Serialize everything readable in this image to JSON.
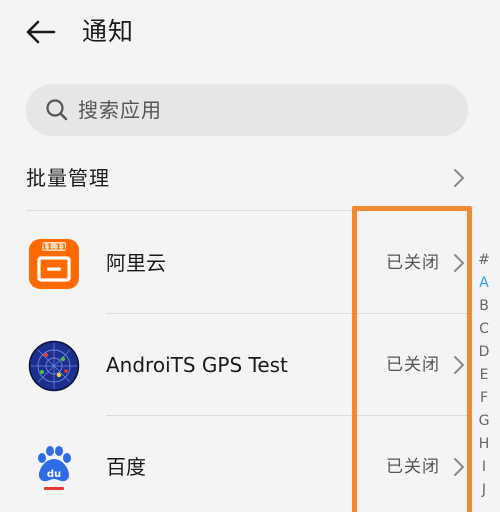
{
  "header": {
    "title": "通知",
    "back_icon": "arrow-left-icon"
  },
  "search": {
    "placeholder": "搜索应用",
    "icon": "search-icon"
  },
  "batch": {
    "label": "批量管理",
    "icon": "chevron-right-icon"
  },
  "apps": [
    {
      "name": "阿里云",
      "status": "已关闭",
      "icon": "aliyun-app-icon",
      "color": "#ff6a00"
    },
    {
      "name": "AndroiTS GPS Test",
      "status": "已关闭",
      "icon": "gps-radar-app-icon",
      "color": "#1c2f8c"
    },
    {
      "name": "百度",
      "status": "已关闭",
      "icon": "baidu-paw-app-icon",
      "color": "#2e6ce6"
    }
  ],
  "index_bar": {
    "letters": [
      "#",
      "A",
      "B",
      "C",
      "D",
      "E",
      "F",
      "G",
      "H",
      "I",
      "J"
    ],
    "active": "A"
  },
  "highlight_color": "#f08a33",
  "accent_color": "#2d9cf2"
}
